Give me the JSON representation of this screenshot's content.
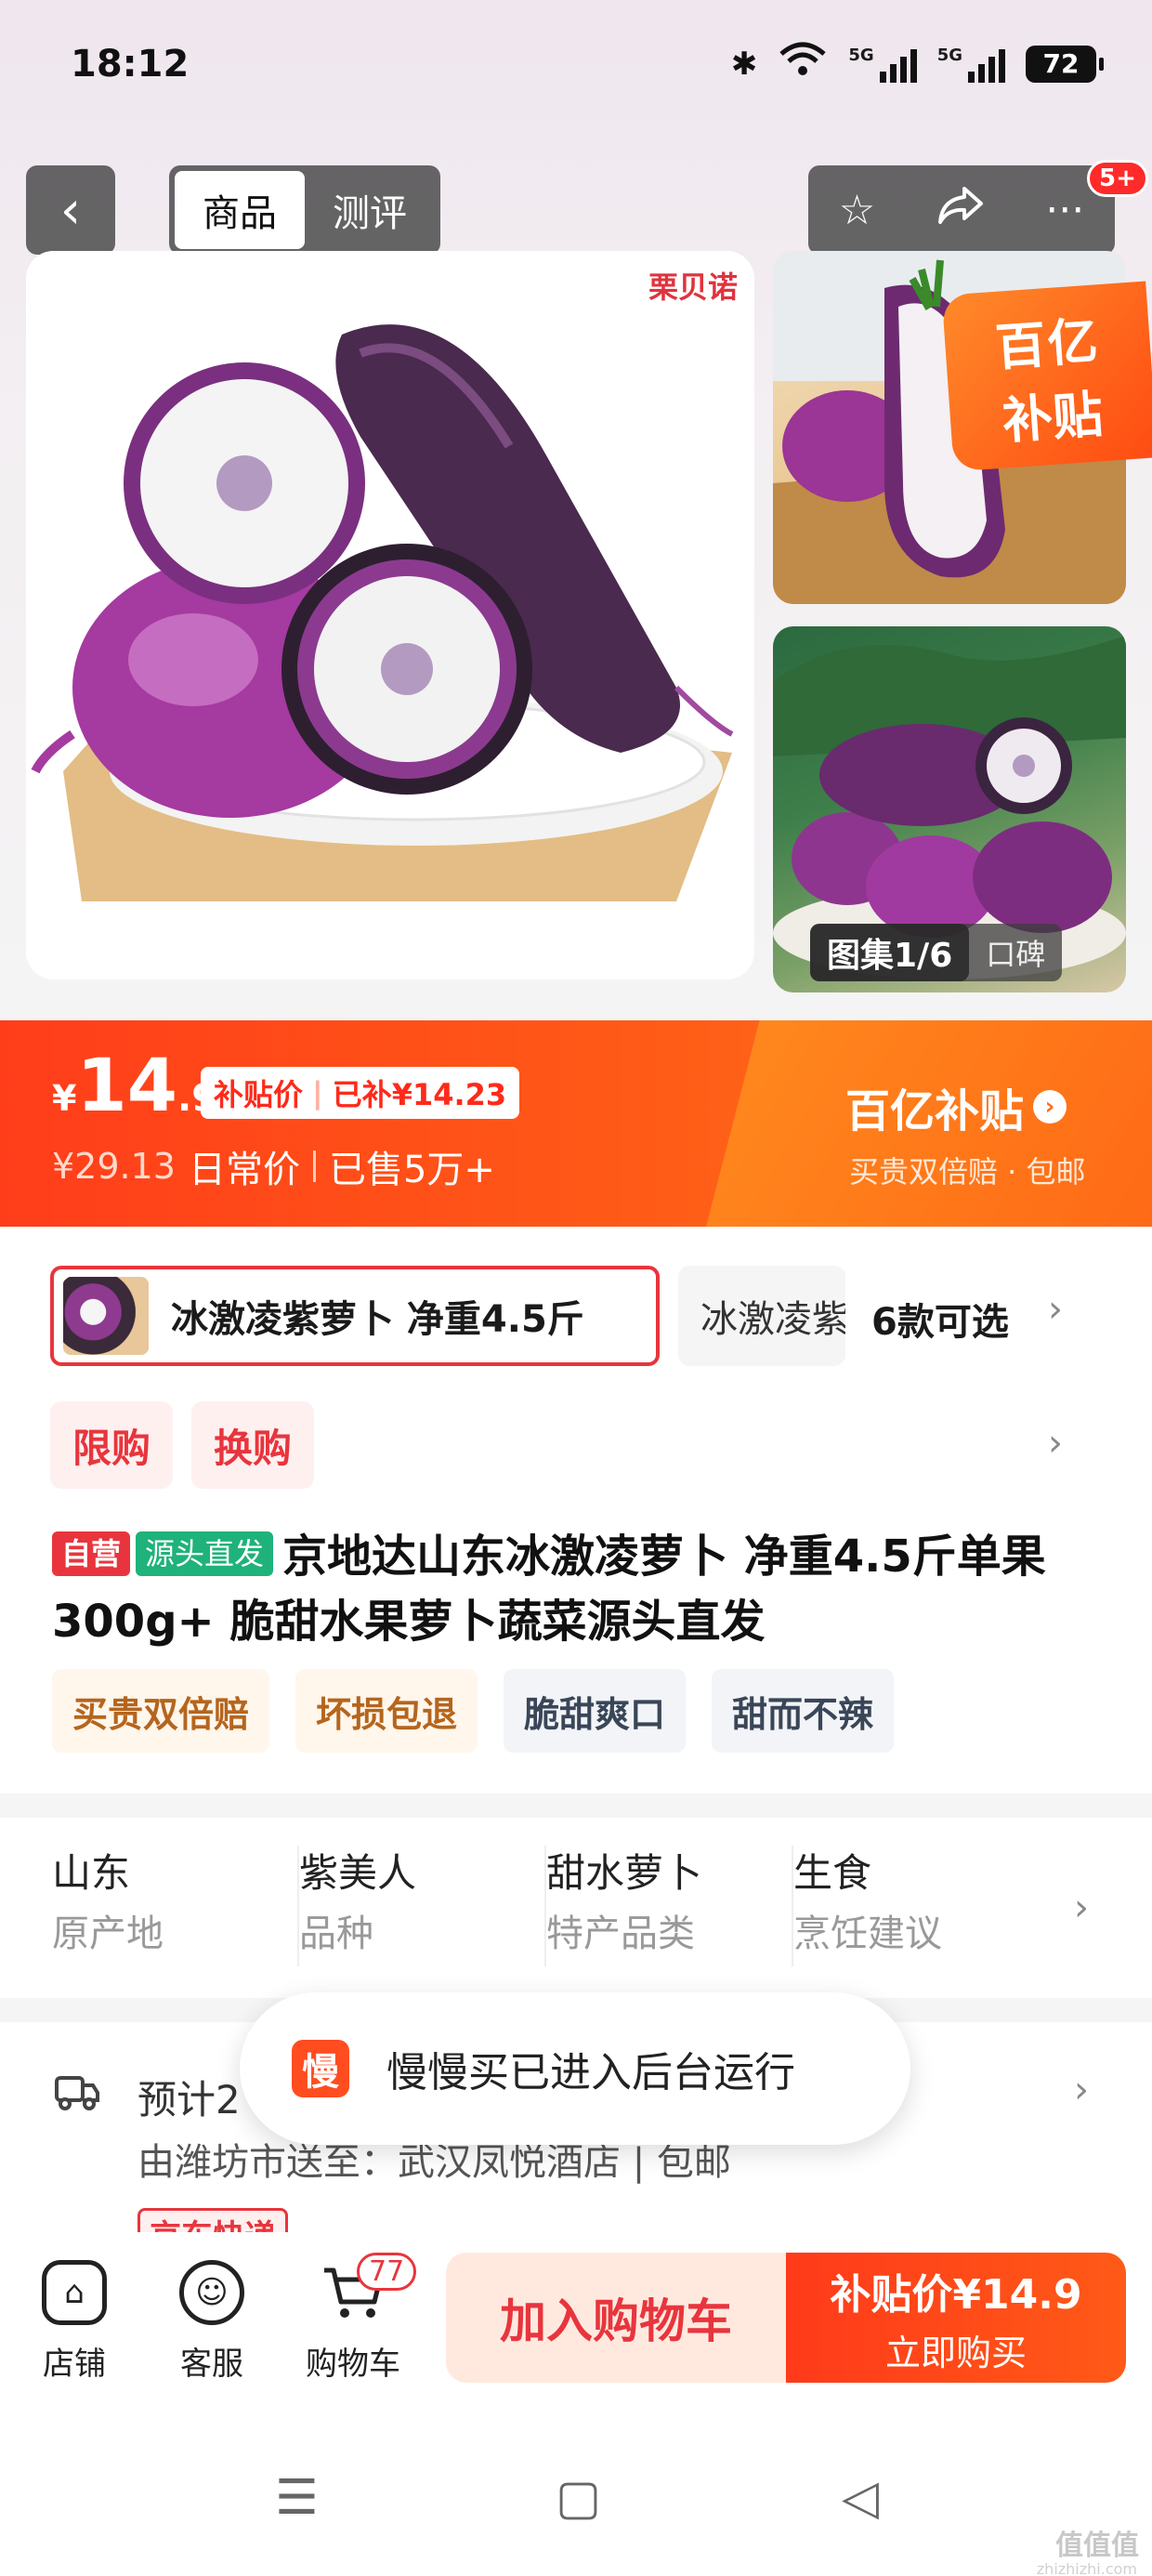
{
  "status_bar": {
    "time": "18:12",
    "signal1": "5G",
    "signal2": "5G",
    "battery": "72"
  },
  "header": {
    "tabs": [
      "商品",
      "测评"
    ],
    "notification_badge": "5+"
  },
  "gallery": {
    "brand_watermark": "栗贝诺",
    "subsidy_corner_line1": "百亿",
    "subsidy_corner_line2": "补贴",
    "counter": "图集1/6",
    "reviews_link": "口碑"
  },
  "price": {
    "currency": "¥",
    "integer": "14",
    "decimal": ".9",
    "subsidy_label": "补贴价",
    "subsidized": "已补¥14.23",
    "original_price": "¥29.13",
    "original_label": "日常价",
    "sold": "已售5万+",
    "program_title": "百亿补贴",
    "program_sub": "买贵双倍赔 · 包邮"
  },
  "sku": {
    "selected": "冰激凌紫萝卜 净重4.5斤",
    "other": "冰激凌紫萝卜",
    "count": "6款可选"
  },
  "limits": [
    "限购",
    "换购"
  ],
  "product": {
    "tag_self": "自营",
    "tag_source": "源头直发",
    "title": "京地达山东冰激凌萝卜 净重4.5斤单果300g+ 脆甜水果萝卜蔬菜源头直发",
    "features": [
      "买贵双倍赔",
      "坏损包退",
      "脆甜爽口",
      "甜而不辣"
    ]
  },
  "attributes": [
    {
      "value": "山东",
      "key": "原产地"
    },
    {
      "value": "紫美人",
      "key": "品种"
    },
    {
      "value": "甜水萝卜",
      "key": "特产品类"
    },
    {
      "value": "生食",
      "key": "烹饪建议"
    }
  ],
  "delivery": {
    "line1": "预计2",
    "line2": "由潍坊市送至：武汉凤悦酒店 | 包邮",
    "carrier": "京东快递"
  },
  "toast": {
    "icon_char": "慢",
    "message": "慢慢买已进入后台运行"
  },
  "bottom_bar": {
    "shop": "店铺",
    "service": "客服",
    "cart": "购物车",
    "cart_count": "77",
    "add_to_cart": "加入购物车",
    "buy_price": "补贴价¥14.9",
    "buy_now": "立即购买"
  },
  "watermark": {
    "main": "值值值",
    "sub": "zhizhizhi.com"
  },
  "colors": {
    "accent_red": "#e8353d",
    "price_orange": "#ff5a17",
    "source_green": "#1fb27a"
  }
}
